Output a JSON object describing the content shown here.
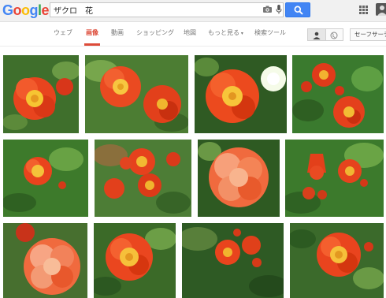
{
  "header": {
    "logo": [
      "G",
      "o",
      "o",
      "g",
      "l",
      "e"
    ],
    "search": {
      "query": "ザクロ　花"
    }
  },
  "tabs": [
    {
      "label": "ウェブ"
    },
    {
      "label": "画像",
      "active": true
    },
    {
      "label": "動画"
    },
    {
      "label": "ショッピング"
    },
    {
      "label": "地図"
    },
    {
      "label": "もっと見る",
      "has_dropdown": true
    },
    {
      "label": "検索ツール"
    }
  ],
  "safesearch_label": "セーフサーチ",
  "colors": {
    "google_blue": "#4285f4",
    "google_red": "#ea4335",
    "google_yellow": "#fbbc05",
    "google_green": "#34a853",
    "active_tab": "#dd4b39",
    "flower": "#e8401c"
  },
  "icons": [
    "camera-icon",
    "mic-icon",
    "search-icon",
    "apps-icon",
    "account-icon",
    "person-icon",
    "globe-icon"
  ],
  "results": {
    "rows": 3,
    "images_per_row": [
      4,
      4,
      4
    ],
    "subject": "pomegranate flowers"
  }
}
